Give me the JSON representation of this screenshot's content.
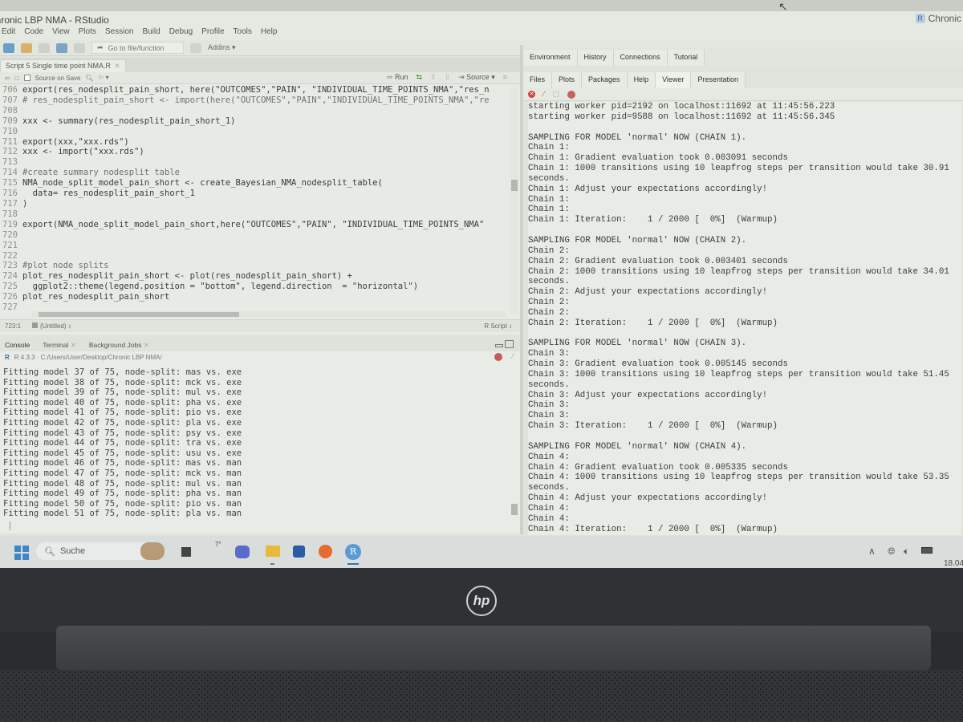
{
  "window": {
    "title": "Chronic LBP NMA - RStudio",
    "project_badge": "Chronic"
  },
  "menubar": [
    "Edit",
    "Code",
    "View",
    "Plots",
    "Session",
    "Build",
    "Debug",
    "Profile",
    "Tools",
    "Help"
  ],
  "toolbar": {
    "goto_placeholder": "Go to file/function",
    "addins_label": "Addins"
  },
  "editor": {
    "tab_label": "Script 5 Single time point NMA.R",
    "source_on_save_label": "Source on Save",
    "run_label": "Run",
    "source_label": "Source",
    "lines": [
      {
        "n": "706",
        "text": "export(res_nodesplit_pain_short, here(\"OUTCOMES\",\"PAIN\", \"INDIVIDUAL_TIME_POINTS_NMA\",\"res_n",
        "comment": false
      },
      {
        "n": "707",
        "text": "# res_nodesplit_pain_short <- import(here(\"OUTCOMES\",\"PAIN\",\"INDIVIDUAL_TIME_POINTS_NMA\",\"re",
        "comment": true
      },
      {
        "n": "708",
        "text": "",
        "comment": false
      },
      {
        "n": "709",
        "text": "xxx <- summary(res_nodesplit_pain_short_1)",
        "comment": false
      },
      {
        "n": "710",
        "text": "",
        "comment": false
      },
      {
        "n": "711",
        "text": "export(xxx,\"xxx.rds\")",
        "comment": false
      },
      {
        "n": "712",
        "text": "xxx <- import(\"xxx.rds\")",
        "comment": false
      },
      {
        "n": "713",
        "text": "",
        "comment": false
      },
      {
        "n": "714",
        "text": "#create summary nodesplit table",
        "comment": true
      },
      {
        "n": "715",
        "text": "NMA_node_split_model_pain_short <- create_Bayesian_NMA_nodesplit_table(",
        "comment": false
      },
      {
        "n": "716",
        "text": "  data= res_nodesplit_pain_short_1",
        "comment": false
      },
      {
        "n": "717",
        "text": ")",
        "comment": false
      },
      {
        "n": "718",
        "text": "",
        "comment": false
      },
      {
        "n": "719",
        "text": "export(NMA_node_split_model_pain_short,here(\"OUTCOMES\",\"PAIN\", \"INDIVIDUAL_TIME_POINTS_NMA\"",
        "comment": false
      },
      {
        "n": "720",
        "text": "",
        "comment": false
      },
      {
        "n": "721",
        "text": "",
        "comment": false
      },
      {
        "n": "722",
        "text": "",
        "comment": false
      },
      {
        "n": "723",
        "text": "#plot node splits",
        "comment": true
      },
      {
        "n": "724",
        "text": "plot_res_nodesplit_pain_short <- plot(res_nodesplit_pain_short) +",
        "comment": false
      },
      {
        "n": "725",
        "text": "  ggplot2::theme(legend.position = \"bottom\", legend.direction  = \"horizontal\")",
        "comment": false
      },
      {
        "n": "726",
        "text": "plot_res_nodesplit_pain_short",
        "comment": false
      },
      {
        "n": "727",
        "text": "",
        "comment": false
      }
    ],
    "status": {
      "position": "723:1",
      "scope": "(Untitled)",
      "language": "R Script"
    }
  },
  "console": {
    "tabs": [
      "Console",
      "Terminal",
      "Background Jobs"
    ],
    "r_version_path": "R 4.3.3 · C:/Users/User/Desktop/Chronic LBP NMA/",
    "lines": [
      "Fitting model 37 of 75, node-split: mas vs. exe",
      "Fitting model 38 of 75, node-split: mck vs. exe",
      "Fitting model 39 of 75, node-split: mul vs. exe",
      "Fitting model 40 of 75, node-split: pha vs. exe",
      "Fitting model 41 of 75, node-split: pio vs. exe",
      "Fitting model 42 of 75, node-split: pla vs. exe",
      "Fitting model 43 of 75, node-split: psy vs. exe",
      "Fitting model 44 of 75, node-split: tra vs. exe",
      "Fitting model 45 of 75, node-split: usu vs. exe",
      "Fitting model 46 of 75, node-split: mas vs. man",
      "Fitting model 47 of 75, node-split: mck vs. man",
      "Fitting model 48 of 75, node-split: mul vs. man",
      "Fitting model 49 of 75, node-split: pha vs. man",
      "Fitting model 50 of 75, node-split: pio vs. man",
      "Fitting model 51 of 75, node-split: pla vs. man"
    ]
  },
  "right_pane": {
    "top_tabs": [
      "Environment",
      "History",
      "Connections",
      "Tutorial"
    ],
    "bottom_tabs": [
      "Files",
      "Plots",
      "Packages",
      "Help",
      "Viewer",
      "Presentation"
    ],
    "selected_bottom_tab": "Viewer",
    "output": "starting worker pid=2192 on localhost:11692 at 11:45:56.223\nstarting worker pid=9588 on localhost:11692 at 11:45:56.345\n\nSAMPLING FOR MODEL 'normal' NOW (CHAIN 1).\nChain 1:\nChain 1: Gradient evaluation took 0.003091 seconds\nChain 1: 1000 transitions using 10 leapfrog steps per transition would take 30.91\nseconds.\nChain 1: Adjust your expectations accordingly!\nChain 1:\nChain 1:\nChain 1: Iteration:    1 / 2000 [  0%]  (Warmup)\n\nSAMPLING FOR MODEL 'normal' NOW (CHAIN 2).\nChain 2:\nChain 2: Gradient evaluation took 0.003401 seconds\nChain 2: 1000 transitions using 10 leapfrog steps per transition would take 34.01\nseconds.\nChain 2: Adjust your expectations accordingly!\nChain 2:\nChain 2:\nChain 2: Iteration:    1 / 2000 [  0%]  (Warmup)\n\nSAMPLING FOR MODEL 'normal' NOW (CHAIN 3).\nChain 3:\nChain 3: Gradient evaluation took 0.005145 seconds\nChain 3: 1000 transitions using 10 leapfrog steps per transition would take 51.45\nseconds.\nChain 3: Adjust your expectations accordingly!\nChain 3:\nChain 3:\nChain 3: Iteration:    1 / 2000 [  0%]  (Warmup)\n\nSAMPLING FOR MODEL 'normal' NOW (CHAIN 4).\nChain 4:\nChain 4: Gradient evaluation took 0.005335 seconds\nChain 4: 1000 transitions using 10 leapfrog steps per transition would take 53.35\nseconds.\nChain 4: Adjust your expectations accordingly!\nChain 4:\nChain 4:\nChain 4: Iteration:    1 / 2000 [  0%]  (Warmup)"
  },
  "taskbar": {
    "search_placeholder": "Suche",
    "weather": "7°",
    "rstudio_icon_letter": "R",
    "clock": "18.04"
  },
  "laptop": {
    "brand": "hp"
  }
}
